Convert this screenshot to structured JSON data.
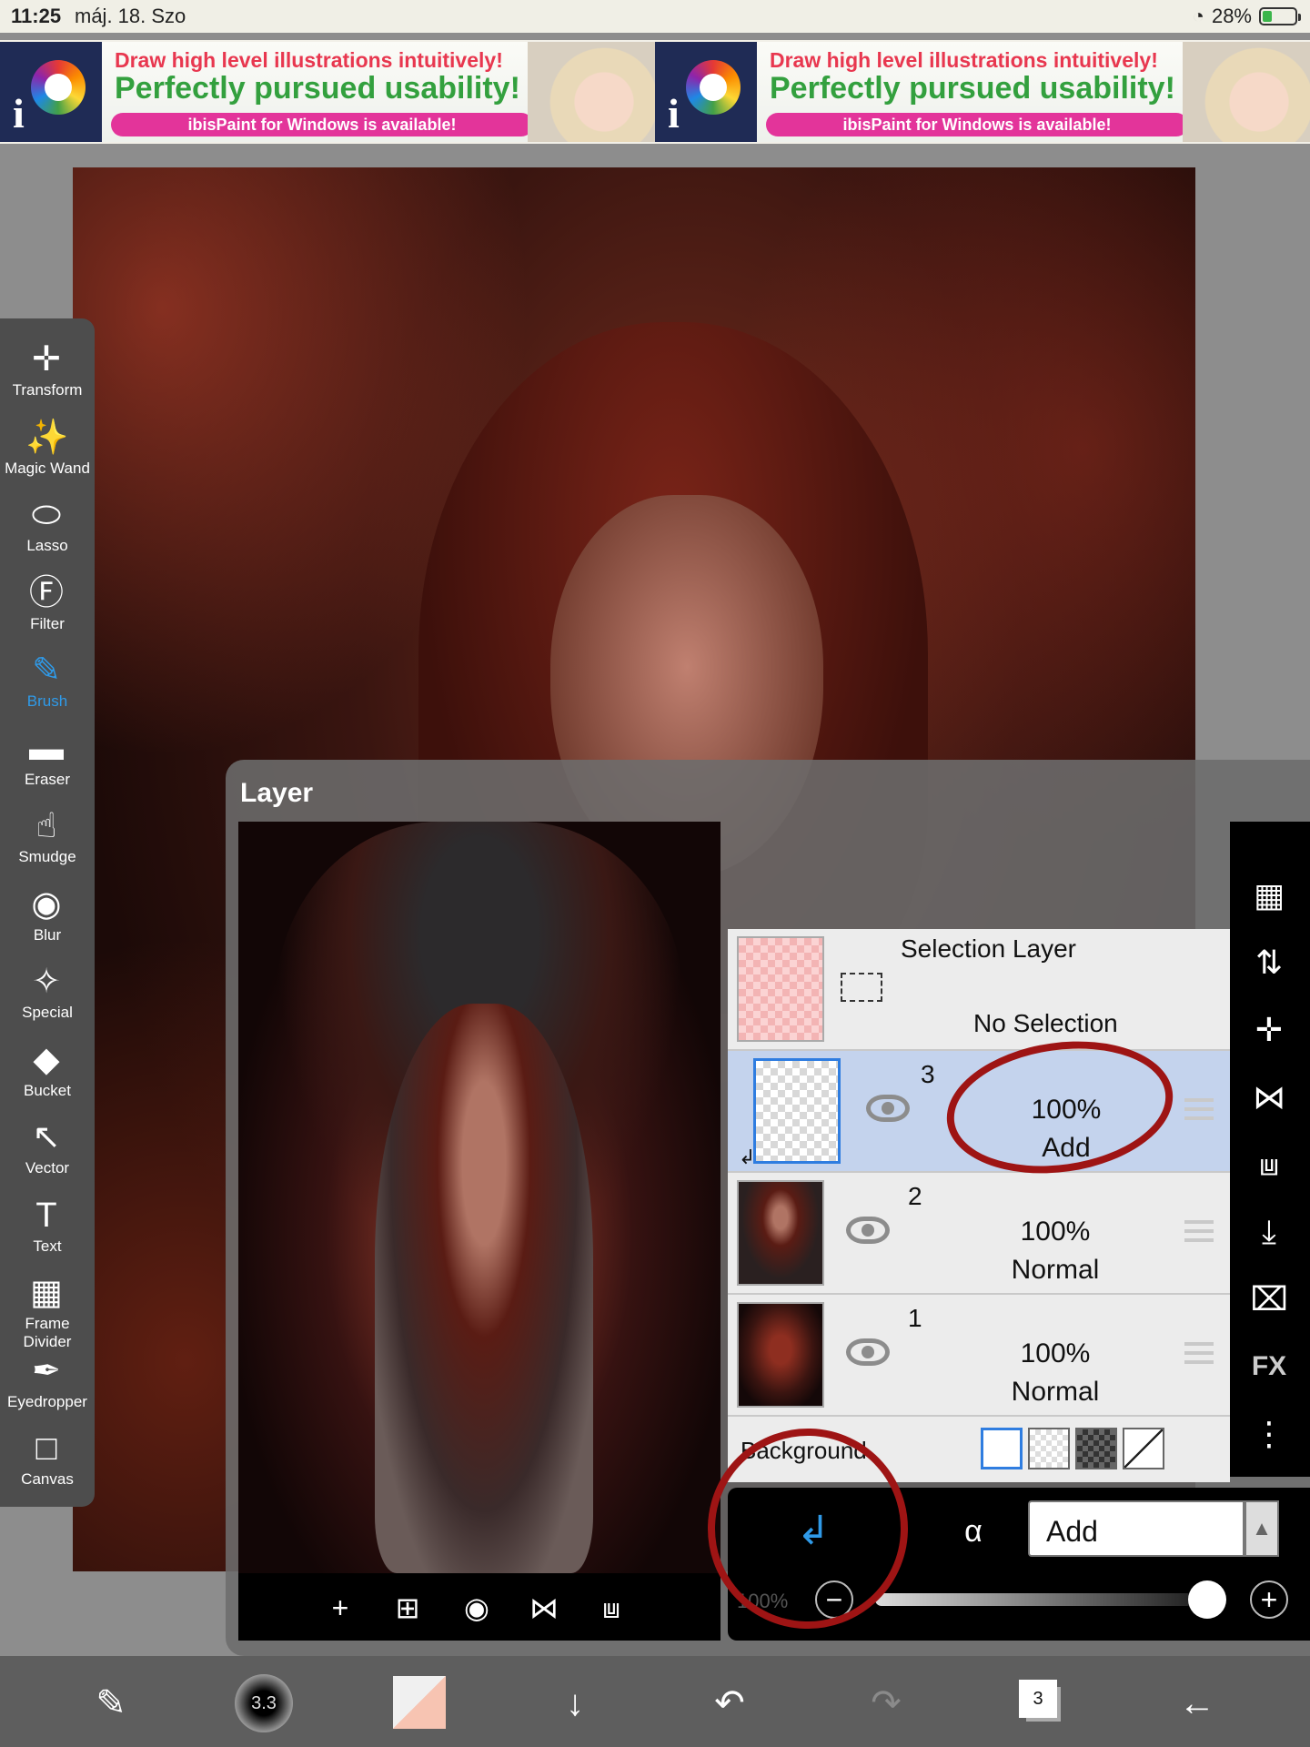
{
  "status": {
    "time": "11:25",
    "date": "máj. 18. Szo",
    "battery": "28%",
    "battery_level": 0.28
  },
  "ad": {
    "line1": "Draw high level illustrations intuitively!",
    "line2": "Perfectly pursued usability!",
    "pill": "ibisPaint for Windows is available!"
  },
  "toolbar": {
    "items": [
      {
        "label": "Transform",
        "icon": "move-arrows-icon"
      },
      {
        "label": "Magic Wand",
        "icon": "magic-wand-icon"
      },
      {
        "label": "Lasso",
        "icon": "lasso-icon"
      },
      {
        "label": "Filter",
        "icon": "fx-icon"
      },
      {
        "label": "Brush",
        "icon": "brush-icon"
      },
      {
        "label": "Eraser",
        "icon": "eraser-icon"
      },
      {
        "label": "Smudge",
        "icon": "smudge-icon"
      },
      {
        "label": "Blur",
        "icon": "drop-icon"
      },
      {
        "label": "Special",
        "icon": "special-pen-icon"
      },
      {
        "label": "Bucket",
        "icon": "bucket-icon"
      },
      {
        "label": "Vector",
        "icon": "cursor-arrow-icon"
      },
      {
        "label": "Text",
        "icon": "text-t-icon"
      },
      {
        "label": "Frame Divider",
        "icon": "frame-divider-icon"
      },
      {
        "label": "Eyedropper",
        "icon": "eyedropper-icon"
      },
      {
        "label": "Canvas",
        "icon": "canvas-icon"
      }
    ],
    "active": "Brush",
    "active_color": "#2f9ae8"
  },
  "panel": {
    "title": "Layer",
    "selection_layer": {
      "name": "Selection Layer",
      "value": "No Selection"
    },
    "layers": [
      {
        "number": "3",
        "opacity": "100%",
        "mode": "Add",
        "selected": true,
        "clipped": true
      },
      {
        "number": "2",
        "opacity": "100%",
        "mode": "Normal",
        "selected": false
      },
      {
        "number": "1",
        "opacity": "100%",
        "mode": "Normal",
        "selected": false
      }
    ],
    "background_label": "Background",
    "blend_mode": "Add",
    "opacity_label": "100%",
    "opacity_value": 1.0,
    "fx_label": "FX"
  },
  "bottom": {
    "brush_size": "3.3",
    "layer_count": "3"
  },
  "colors": {
    "annotation": "#9e1414",
    "selection_blue": "#2f7de0"
  }
}
